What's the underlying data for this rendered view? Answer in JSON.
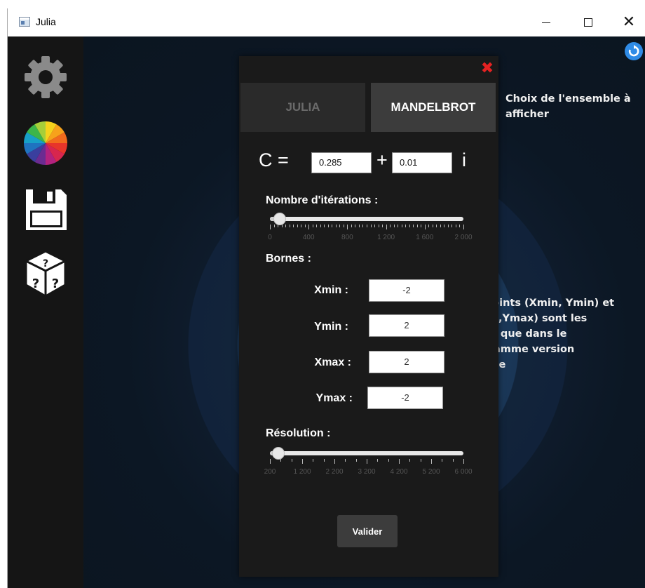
{
  "window": {
    "title": "Julia",
    "minimize_glyph": "—",
    "maximize_glyph": "☐",
    "close_glyph": "✕"
  },
  "sidebar": {
    "items": [
      {
        "icon": "gear-icon",
        "label": "Settings"
      },
      {
        "icon": "color-wheel-icon",
        "label": "Colors"
      },
      {
        "icon": "floppy-disk-icon",
        "label": "Save"
      },
      {
        "icon": "random-dice-icon",
        "label": "Random"
      }
    ]
  },
  "dialog": {
    "close_glyph": "✖",
    "tabs": {
      "julia": "JULIA",
      "mandelbrot": "MANDELBROT",
      "selected": "MANDELBROT"
    },
    "c": {
      "label": "C =",
      "real": "0.285",
      "plus": "+",
      "imaginary": "0.01",
      "i": "i"
    },
    "iterations": {
      "label": "Nombre d'itérations :",
      "value": 100,
      "min": 0,
      "max": 2000,
      "tick_labels": [
        "0",
        "400",
        "800",
        "1 200",
        "1 600",
        "2 000"
      ]
    },
    "bounds": {
      "label": "Bornes :",
      "xmin_label": "Xmin :",
      "xmin": "-2",
      "ymin_label": "Ymin :",
      "ymin": "2",
      "xmax_label": "Xmax :",
      "xmax": "2",
      "ymax_label": "Ymax :",
      "ymax": "-2"
    },
    "resolution": {
      "label": "Résolution :",
      "value": 450,
      "min": 200,
      "max": 6000,
      "tick_labels": [
        "200",
        "1 200",
        "2 200",
        "3 200",
        "4 200",
        "5 200",
        "6 000"
      ]
    },
    "validate_label": "Valider"
  },
  "annotations": {
    "tab_choice": "Choix de l'ensemble à afficher",
    "bounds_note": "Les points (Xmin, Ymin) et (Xmax,Ymax) sont les même que dans le programme version console"
  },
  "colors": {
    "accent_blue": "#2f8be6",
    "close_red": "#e52222",
    "dialog_bg": "#1a1a1a"
  }
}
